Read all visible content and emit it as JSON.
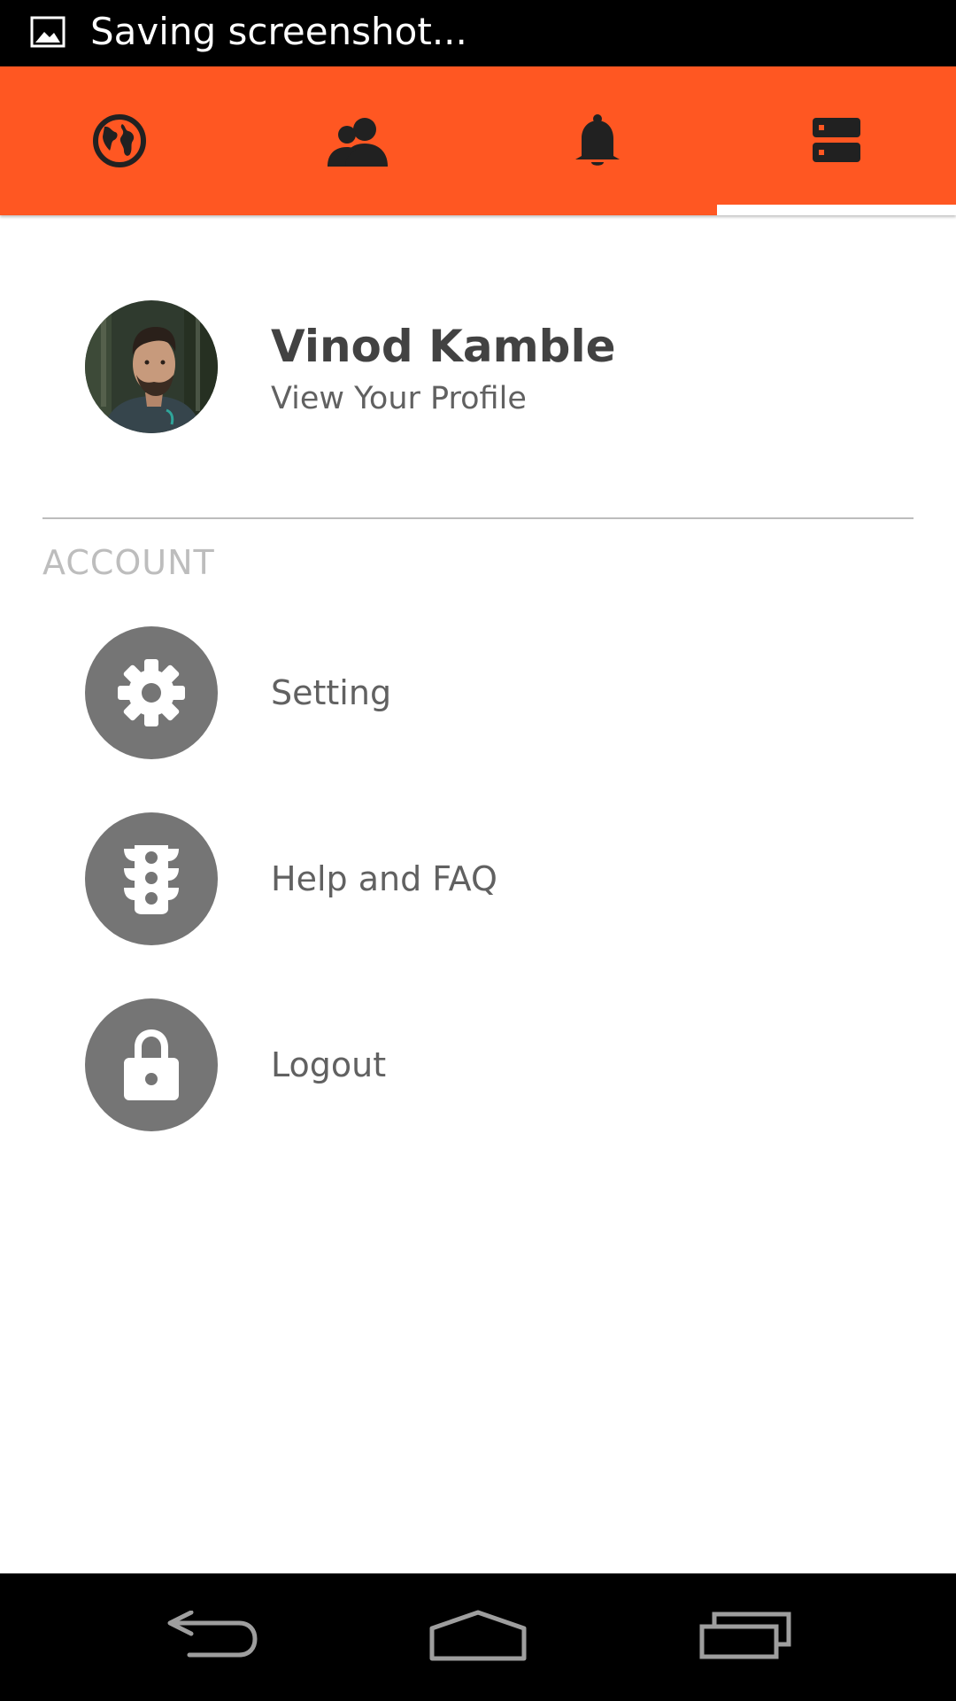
{
  "status_bar": {
    "notification_icon": "image-icon",
    "text": "Saving screenshot..."
  },
  "tabs": [
    {
      "icon": "globe-icon",
      "selected": false
    },
    {
      "icon": "people-icon",
      "selected": false
    },
    {
      "icon": "bell-icon",
      "selected": false
    },
    {
      "icon": "list-icon",
      "selected": true
    }
  ],
  "profile": {
    "name": "Vinod Kamble",
    "subtitle": "View Your Profile",
    "avatar_icon": "avatar-photo"
  },
  "account_section": {
    "title": "ACCOUNT",
    "items": [
      {
        "label": "Setting",
        "icon": "gear-icon"
      },
      {
        "label": "Help and FAQ",
        "icon": "traffic-light-icon"
      },
      {
        "label": "Logout",
        "icon": "lock-icon"
      }
    ]
  },
  "nav_bar": {
    "back_icon": "back-icon",
    "home_icon": "home-icon",
    "recents_icon": "recents-icon"
  },
  "colors": {
    "accent": "#ff5722",
    "icon_circle": "#757575",
    "text_dark": "#424242",
    "text_muted": "#616161",
    "section_title": "#bdbdbd"
  }
}
